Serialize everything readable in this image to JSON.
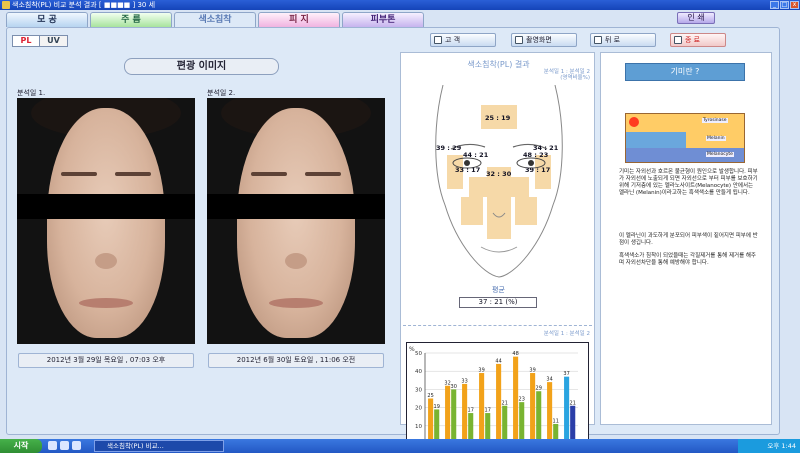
{
  "window": {
    "title": "색소침착(PL) 비교 분석 결과 [ ■■■■ ] 30 세"
  },
  "tabs": [
    {
      "label": "모 공"
    },
    {
      "label": "주 름"
    },
    {
      "label": "색소침착"
    },
    {
      "label": "피 지"
    },
    {
      "label": "피부톤"
    }
  ],
  "print_label": "인 쇄",
  "mode": {
    "pl": "PL",
    "uv": "UV"
  },
  "left": {
    "image_title": "편광 이미지",
    "date1_label": "분석일 1.",
    "date2_label": "분석일 2.",
    "date1_value": "2012년 3월 29일 목요일 , 07:03 오후",
    "date2_value": "2012년 6월 30일 토요일 , 11:06 오전"
  },
  "toolbar": {
    "customer": "고 객",
    "capture": "촬영화면",
    "back": "뒤 로",
    "exit": "종 료"
  },
  "result": {
    "title": "색소침착(PL) 결과",
    "legend1": "분석일 1 : 분석일 2",
    "legend2": "(영역비율%)",
    "zones": {
      "forehead": "25 : 19",
      "left_cheek_upper": "39 : 29",
      "right_cheek_upper": "34 : 21",
      "left_under_eye": "44 : 21",
      "right_under_eye": "48 : 23",
      "left_cheek": "33 : 17",
      "nose": "32 : 30",
      "right_cheek": "39 : 17"
    },
    "avg_label": "평균",
    "avg_value": "37 : 21 (%)",
    "chart_legend": "분석일 1 : 분석일 2"
  },
  "chart_data": {
    "type": "bar",
    "categories": [
      "A",
      "B",
      "C",
      "D",
      "E",
      "F",
      "G",
      "H",
      "I"
    ],
    "series": [
      {
        "values": [
          25,
          32,
          33,
          39,
          44,
          48,
          39,
          34,
          37
        ],
        "color": "#f2a21a"
      },
      {
        "values": [
          19,
          30,
          17,
          17,
          21,
          23,
          29,
          11,
          21
        ],
        "color": "#79b431"
      }
    ],
    "last_series_colors": [
      "#2aa4e0",
      "#2b3ea8"
    ],
    "ylabel": "%",
    "yticks": [
      0,
      10,
      20,
      30,
      40,
      50
    ],
    "ylim": [
      0,
      50
    ],
    "xlabel_suffix": "부위"
  },
  "right": {
    "title": "기미란 ?",
    "diagram_labels": {
      "tyrosinase": "Tyrosinase",
      "melanin": "Melanin",
      "melanocyte": "Melanocyte"
    },
    "para1": "기미는 자외선과 호르몬 불균형이 원인으로 발생합니다. 피부가 자외선에 노출되게 되면 자외선으로 부터 피부를 보호하기 위해 기저층에 있는 멜라노사이트(Melanocyte) 안에서는 멜라닌 (Melanin)이라고하는 흑색색소를 만들게 됩니다.",
    "para2": "이 멜라닌이 과도하게 분포되어 피부색이 짙어지면 피부에 반점이 생깁니다.",
    "para3": "흑색색소가 침착이 되었을때는 각질제거를 통해 제거를 해주며 자외선차단을 통해 예방해야 합니다."
  },
  "taskbar": {
    "start": "시작",
    "task_item": "색소침착(PL) 비교...",
    "clock": "오후 1:44"
  },
  "colors": {
    "accent": "#5e9ed4",
    "chart_orange": "#f2a21a",
    "chart_green": "#79b431"
  }
}
